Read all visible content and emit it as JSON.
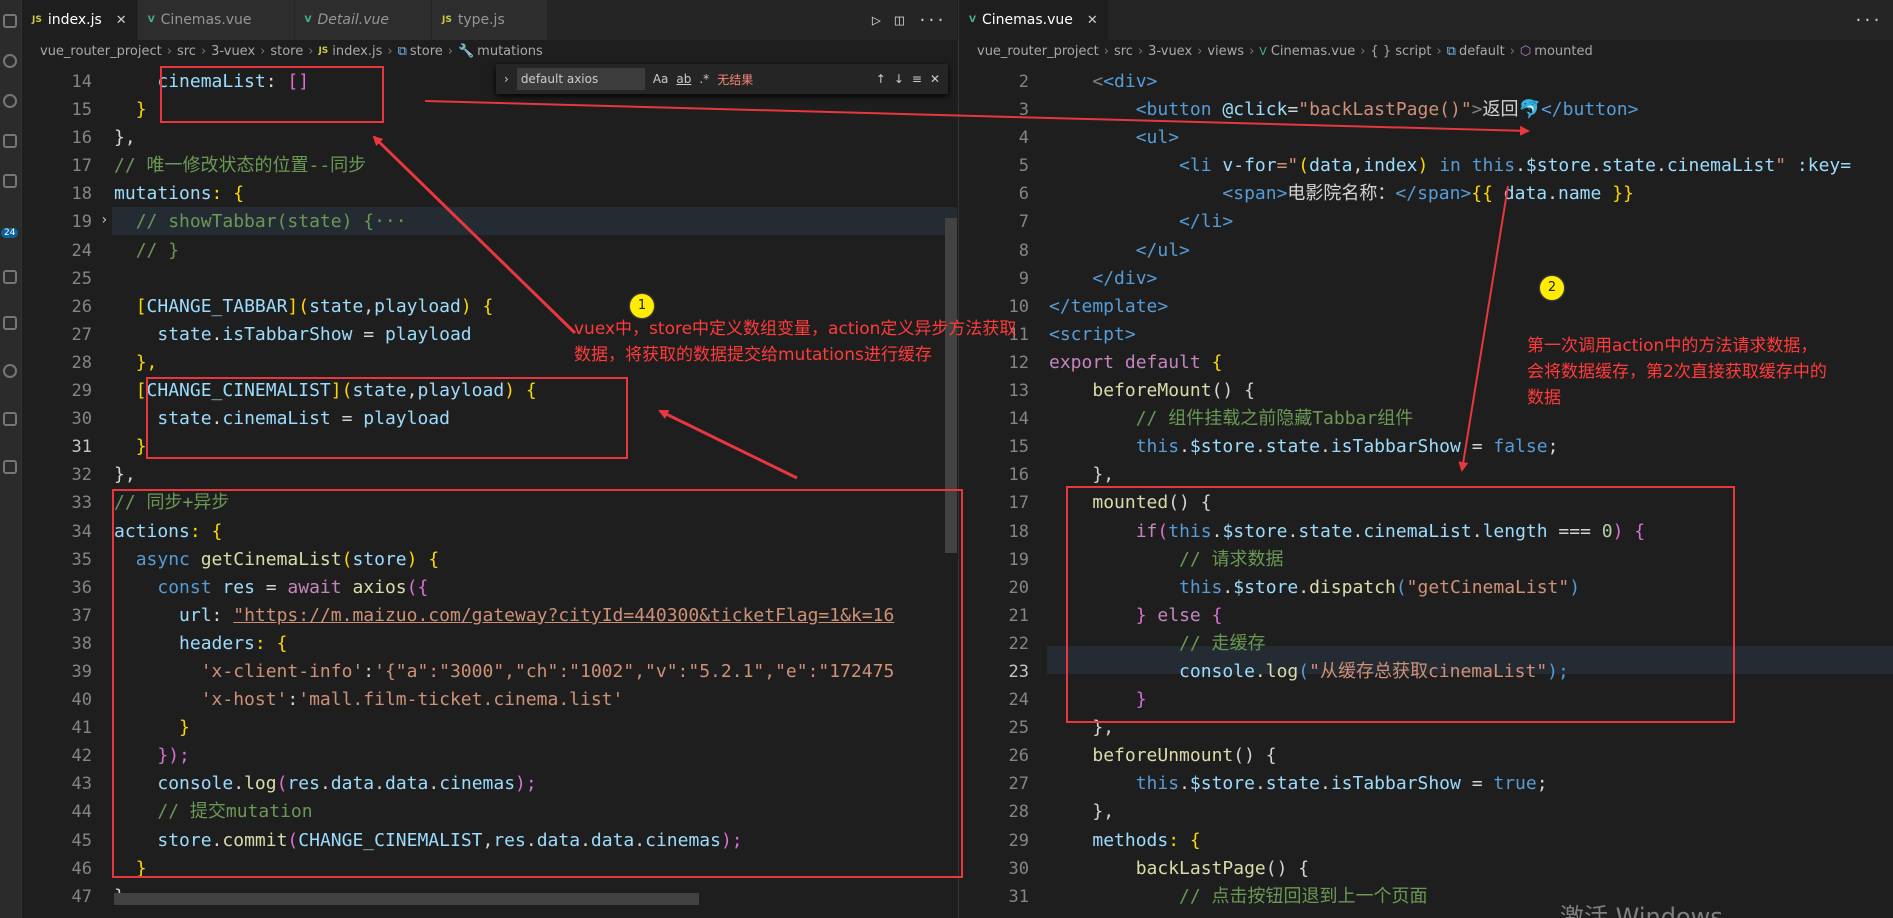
{
  "left": {
    "tabs": [
      {
        "icon": "JS",
        "name": "index.js",
        "active": true
      },
      {
        "icon": "V",
        "name": "Cinemas.vue"
      },
      {
        "icon": "V",
        "name": "Detail.vue"
      },
      {
        "icon": "JS",
        "name": "type.js"
      }
    ],
    "breadcrumb": [
      "vue_router_project",
      "src",
      "3-vuex",
      "store",
      "index.js",
      "store",
      "mutations"
    ],
    "find": {
      "query": "default axios",
      "opts": [
        "Aa",
        "ab",
        ".*"
      ],
      "result": "无结果"
    },
    "lines": [
      "14",
      "15",
      "16",
      "17",
      "18",
      "19",
      "24",
      "25",
      "26",
      "27",
      "28",
      "29",
      "30",
      "31",
      "32",
      "33",
      "34",
      "35",
      "36",
      "37",
      "38",
      "39",
      "40",
      "41",
      "42",
      "43",
      "44",
      "45",
      "46",
      "47"
    ],
    "current_line": "31",
    "code": {
      "l14a": "cinemaList",
      "l14b": ": ",
      "l14c": "[]",
      "l15": "}",
      "l16": "},",
      "l17": "// 唯一修改状态的位置--同步",
      "l18a": "mutations",
      "l18b": ": {",
      "l19": "// showTabbar(state) {···",
      "l24": "// }",
      "l26a": "[",
      "l26b": "CHANGE_TABBAR",
      "l26c": "](",
      "l26d": "state",
      "l26e": ",",
      "l26f": "playload",
      "l26g": ") {",
      "l27a": "state",
      "l27b": ".",
      "l27c": "isTabbarShow",
      "l27d": " = ",
      "l27e": "playload",
      "l28": "},",
      "l29a": "[",
      "l29b": "CHANGE_CINEMALIST",
      "l29c": "](",
      "l29d": "state",
      "l29e": ",",
      "l29f": "playload",
      "l29g": ") {",
      "l30a": "state",
      "l30b": ".",
      "l30c": "cinemaList",
      "l30d": " = ",
      "l30e": "playload",
      "l31": "}",
      "l32": "},",
      "l33": "// 同步+异步",
      "l34a": "actions",
      "l34b": ": {",
      "l35a": "async ",
      "l35b": "getCinemaList",
      "l35c": "(",
      "l35d": "store",
      "l35e": ") {",
      "l36a": "const ",
      "l36b": "res",
      "l36c": " = ",
      "l36d": "await ",
      "l36e": "axios",
      "l36f": "({",
      "l37a": "url",
      "l37b": ": ",
      "l37c": "\"https://m.maizuo.com/gateway?cityId=440300&ticketFlag=1&k=16",
      "l38a": "headers",
      "l38b": ": {",
      "l39a": "'x-client-info'",
      "l39b": ":",
      "l39c": "'{\"a\":\"3000\",\"ch\":\"1002\",\"v\":\"5.2.1\",\"e\":\"172475",
      "l40a": "'x-host'",
      "l40b": ":",
      "l40c": "'mall.film-ticket.cinema.list'",
      "l41": "}",
      "l42": "});",
      "l43a": "console",
      "l43b": ".",
      "l43c": "log",
      "l43d": "(",
      "l43e": "res",
      "l43f": ".",
      "l43g": "data",
      "l43h": ".",
      "l43i": "data",
      "l43j": ".",
      "l43k": "cinemas",
      "l43l": ");",
      "l44": "// 提交mutation",
      "l45a": "store",
      "l45b": ".",
      "l45c": "commit",
      "l45d": "(",
      "l45e": "CHANGE_CINEMALIST",
      "l45f": ",",
      "l45g": "res",
      "l45h": ".",
      "l45i": "data",
      "l45j": ".",
      "l45k": "data",
      "l45l": ".",
      "l45m": "cinemas",
      "l45n": ");",
      "l46": "}",
      "l47": "},"
    }
  },
  "right": {
    "tabs": [
      {
        "icon": "V",
        "name": "Cinemas.vue",
        "active": true
      }
    ],
    "breadcrumb": [
      "vue_router_project",
      "src",
      "3-vuex",
      "views",
      "Cinemas.vue",
      "{ } script",
      "default",
      "mounted"
    ],
    "lines": [
      "2",
      "3",
      "4",
      "5",
      "6",
      "7",
      "8",
      "9",
      "10",
      "11",
      "12",
      "13",
      "14",
      "15",
      "16",
      "17",
      "18",
      "19",
      "20",
      "21",
      "22",
      "23",
      "24",
      "25",
      "26",
      "27",
      "28",
      "29",
      "30",
      "31"
    ],
    "current_line": "23",
    "code": {
      "r2": "<div>",
      "r3a": "<button ",
      "r3b": "@click",
      "r3c": "=",
      "r3d": "\"backLastPage()\"",
      "r3e": ">",
      "r3f": "返回🐬",
      "r3g": "</button>",
      "r4": "<ul>",
      "r5a": "<li ",
      "r5b": "v-for",
      "r5c": "=\"",
      "r5d": "(",
      "r5e": "data",
      "r5f": ",",
      "r5g": "index",
      "r5h": ") ",
      "r5i": "in ",
      "r5j": "this",
      "r5k": ".",
      "r5l": "$store",
      "r5m": ".",
      "r5n": "state",
      "r5o": ".",
      "r5p": "cinemaList",
      "r5q": "\" ",
      "r5r": ":key=",
      "r6a": "<span>",
      "r6b": "电影院名称：",
      "r6c": "</span>",
      "r6d": "{{ ",
      "r6e": "data",
      "r6f": ".",
      "r6g": "name",
      "r6h": " }}",
      "r7": "</li>",
      "r8": "</ul>",
      "r9": "</div>",
      "r10": "</template>",
      "r11": "<script>",
      "r12a": "export ",
      "r12b": "default ",
      "r12c": "{",
      "r13a": "beforeMount",
      "r13b": "() {",
      "r14": "// 组件挂载之前隐藏Tabbar组件",
      "r15a": "this",
      "r15b": ".",
      "r15c": "$store",
      "r15d": ".",
      "r15e": "state",
      "r15f": ".",
      "r15g": "isTabbarShow",
      "r15h": " = ",
      "r15i": "false",
      "r15j": ";",
      "r16": "},",
      "r17a": "mounted",
      "r17b": "() {",
      "r18a": "if",
      "r18b": "(",
      "r18c": "this",
      "r18d": ".",
      "r18e": "$store",
      "r18f": ".",
      "r18g": "state",
      "r18h": ".",
      "r18i": "cinemaList",
      "r18j": ".",
      "r18k": "length",
      "r18l": " === ",
      "r18m": "0",
      "r18n": ") {",
      "r19": "// 请求数据",
      "r20a": "this",
      "r20b": ".",
      "r20c": "$store",
      "r20d": ".",
      "r20e": "dispatch",
      "r20f": "(",
      "r20g": "\"getCinemaList\"",
      "r20h": ")",
      "r21a": "} ",
      "r21b": "else ",
      "r21c": "{",
      "r22": "// 走缓存",
      "r23a": "console",
      "r23b": ".",
      "r23c": "log",
      "r23d": "(",
      "r23e": "\"从缓存总获取cinemaList\"",
      "r23f": ");",
      "r24": "}",
      "r25": "},",
      "r26a": "beforeUnmount",
      "r26b": "() {",
      "r27a": "this",
      "r27b": ".",
      "r27c": "$store",
      "r27d": ".",
      "r27e": "state",
      "r27f": ".",
      "r27g": "isTabbarShow",
      "r27h": " = ",
      "r27i": "true",
      "r27j": ";",
      "r28": "},",
      "r29a": "methods",
      "r29b": ": {",
      "r30a": "backLastPage",
      "r30b": "() {",
      "r31": "// 点击按钮回退到上一个页面"
    }
  },
  "annotations": {
    "marker1": "1",
    "marker2": "2",
    "note1_line1": "vuex中，store中定义数组变量，action定义异步方法获取",
    "note1_line2": "数据，将获取的数据提交给mutations进行缓存",
    "note2_line1": "第一次调用action中的方法请求数据，",
    "note2_line2": "会将数据缓存，第2次直接获取缓存中的",
    "note2_line3": "数据",
    "color": "#e8373f"
  },
  "activity_badge": "24",
  "watermark": "激活 Windows"
}
